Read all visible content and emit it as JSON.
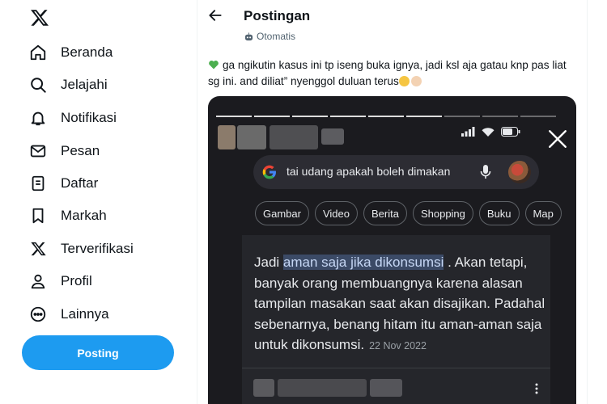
{
  "sidebar": {
    "logo_icon": "x-logo-icon",
    "items": [
      {
        "label": "Beranda",
        "icon": "home-icon"
      },
      {
        "label": "Jelajahi",
        "icon": "search-icon"
      },
      {
        "label": "Notifikasi",
        "icon": "bell-icon"
      },
      {
        "label": "Pesan",
        "icon": "mail-icon"
      },
      {
        "label": "Daftar",
        "icon": "list-icon"
      },
      {
        "label": "Markah",
        "icon": "bookmark-icon"
      },
      {
        "label": "Terverifikasi",
        "icon": "x-logo-icon"
      },
      {
        "label": "Profil",
        "icon": "person-icon"
      },
      {
        "label": "Lainnya",
        "icon": "more-circle-icon"
      }
    ],
    "post_button": "Posting"
  },
  "header": {
    "title": "Postingan",
    "auto_label": "Otomatis"
  },
  "tweet": {
    "text_before": "ga ngikutin kasus ini tp iseng buka ignya, jadi ksl aja gatau knp pas liat sg ini. and diliat” nyenggol duluan terus"
  },
  "media": {
    "search_query": "tai udang apakah boleh dimakan",
    "chips": [
      "Gambar",
      "Video",
      "Berita",
      "Shopping",
      "Buku",
      "Map"
    ],
    "answer_prefix": "Jadi ",
    "answer_highlight": "aman saja jika dikonsumsi",
    "answer_rest": " . Akan tetapi, banyak orang membuangnya karena alasan tampilan masakan saat akan disajikan. Padahal sebenarnya, benang hitam itu aman-aman saja untuk dikonsumsi.",
    "answer_date": "22 Nov 2022"
  },
  "colors": {
    "accent": "#1d9bf0",
    "text_primary": "#0f1419",
    "text_secondary": "#536471",
    "media_bg": "#1b1b1f",
    "highlight": "#3b4a66"
  }
}
